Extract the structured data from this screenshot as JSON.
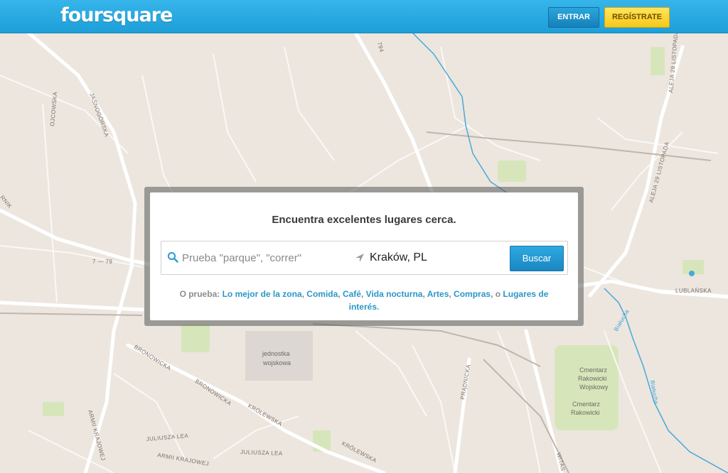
{
  "header": {
    "logo_text": "foursquare",
    "login_label": "ENTRAR",
    "signup_label": "REGÍSTRATE",
    "colors": {
      "bar": "#25a8e0",
      "login_button": "#1c8fcb",
      "signup_button": "#f8d137"
    }
  },
  "search": {
    "title": "Encuentra excelentes lugares cerca.",
    "query_placeholder": "Prueba \"parque\", \"correr\"",
    "location_value": "Kraków, PL",
    "button_label": "Buscar",
    "suggestions_prefix": "O prueba:",
    "suggestions": [
      "Lo mejor de la zona",
      "Comida",
      "Café",
      "Vida nocturna",
      "Artes",
      "Compras",
      "Lugares de interés"
    ],
    "separator": ",",
    "last_connector": ", o",
    "terminator": "."
  },
  "map": {
    "streets": {
      "ojcowska": "OJCOWSKA",
      "jasnogorska": "JASNOGÓRSKA",
      "rnik": "RNIK",
      "route_79": "7 — 79",
      "route_794": "794",
      "aleja_29_listopada_1": "ALEJA 29 LISTOPADA",
      "aleja_29_listopada_2": "ALEJA 29 LISTOPADA",
      "lublanska": "LUBLAŃSKA",
      "bronowicka_1": "BRONOWICKA",
      "bronowicka_2": "BRONOWICKA",
      "krolewska_1": "KRÓLEWSKA",
      "krolewska_2": "KRÓLEWSKA",
      "armii_krajowej_1": "ARMII KRAJOWEJ",
      "armii_krajowej_2": "ARMII KRAJOWEJ",
      "juliusza_lea_1": "JULIUSZA LEA",
      "juliusza_lea_2": "JULIUSZA LEA",
      "pradnicka": "PRĄDNICKA",
      "witas": "WITAS",
      "bialucha_1": "Białucha",
      "bialucha_2": "Białucha"
    },
    "areas": {
      "jednostka_1": "jednostka",
      "jednostka_2": "wojskowa",
      "cmentarz_wojskowy_1": "Cmentarz",
      "cmentarz_wojskowy_2": "Rakowicki",
      "cmentarz_wojskowy_3": "Wojskowy",
      "cmentarz_rakowicki_1": "Cmentarz",
      "cmentarz_rakowicki_2": "Rakowicki"
    },
    "colors": {
      "land": "#ece6df",
      "road": "#ffffff",
      "water": "#4aa8d8",
      "park": "#cfe3b0",
      "rail": "#b9b2ab"
    }
  }
}
